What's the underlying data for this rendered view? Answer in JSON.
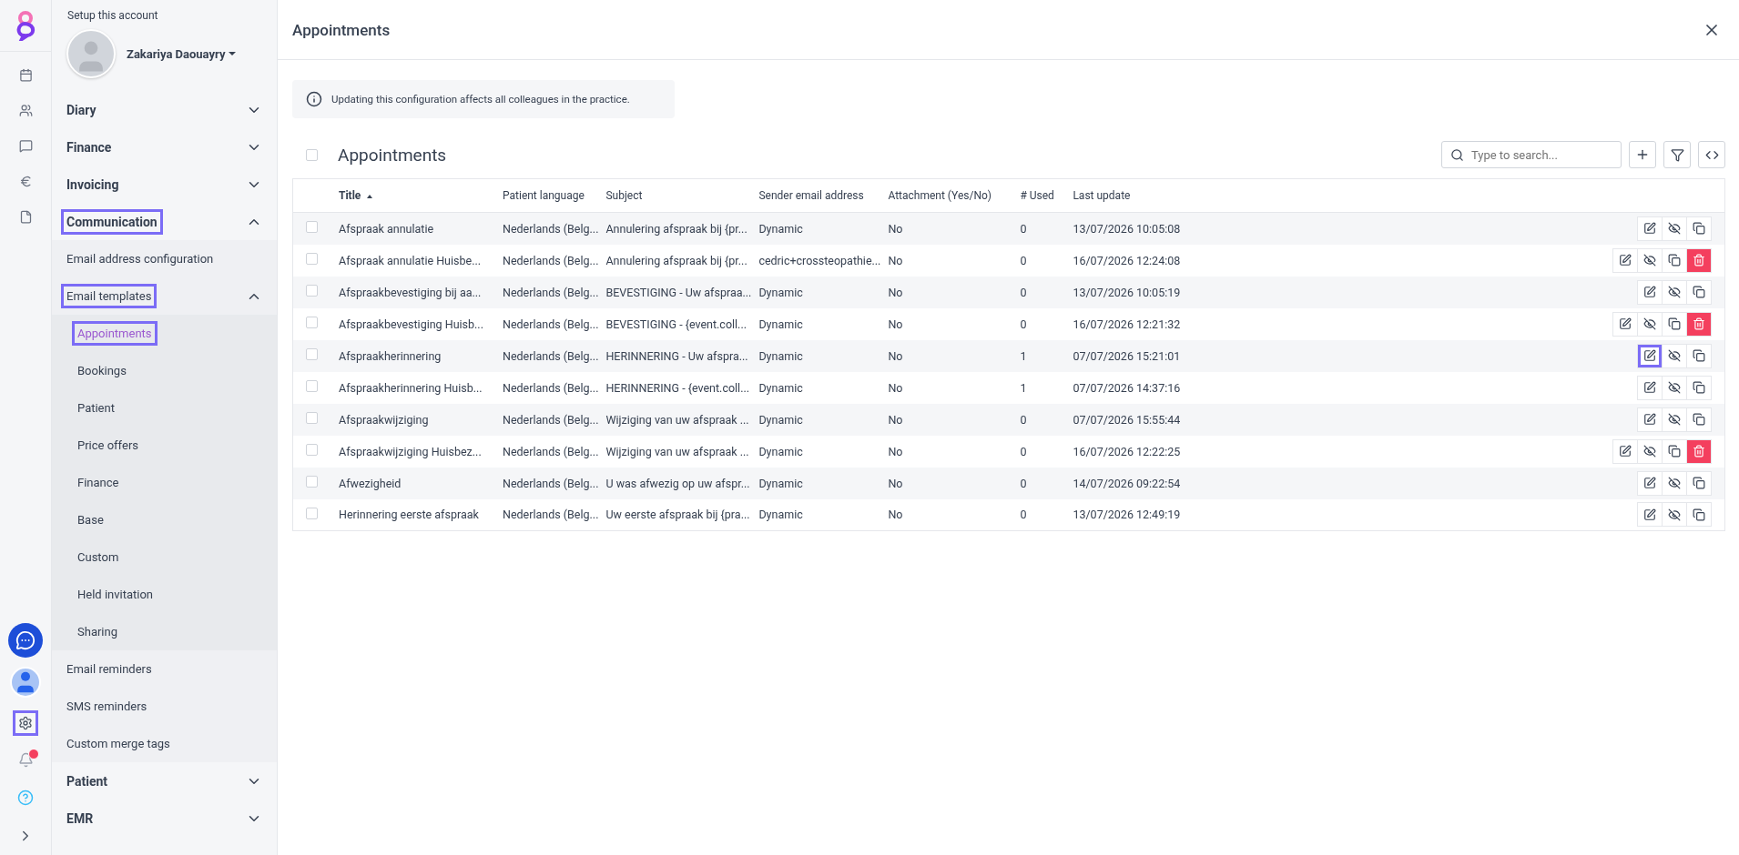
{
  "rail": {
    "top": [
      {
        "kind": "calendar"
      },
      {
        "kind": "users"
      },
      {
        "kind": "message"
      },
      {
        "kind": "euro"
      },
      {
        "kind": "file"
      }
    ],
    "bottom": [
      {
        "kind": "chat",
        "highlighted": false
      },
      {
        "kind": "avatar",
        "highlighted": false
      },
      {
        "kind": "settings",
        "highlighted": true
      },
      {
        "kind": "bell",
        "highlighted": false
      },
      {
        "kind": "help",
        "highlighted": false
      },
      {
        "kind": "expand",
        "highlighted": false
      }
    ]
  },
  "sidebar": {
    "caption": "Setup this account",
    "user": "Zakariya Daouayry",
    "sections": [
      {
        "label": "Diary",
        "expanded": false,
        "highlighted": false
      },
      {
        "label": "Finance",
        "expanded": false,
        "highlighted": false
      },
      {
        "label": "Invoicing",
        "expanded": false,
        "highlighted": false
      },
      {
        "label": "Communication",
        "expanded": true,
        "highlighted": true,
        "children": [
          {
            "label": "Email address configuration",
            "highlighted": false
          },
          {
            "label": "Email templates",
            "highlighted": true,
            "expanded": true,
            "children": [
              {
                "label": "Appointments",
                "selected": true,
                "highlighted": true
              },
              {
                "label": "Bookings",
                "selected": false,
                "highlighted": false
              },
              {
                "label": "Patient",
                "selected": false,
                "highlighted": false
              },
              {
                "label": "Price offers",
                "selected": false,
                "highlighted": false
              },
              {
                "label": "Finance",
                "selected": false,
                "highlighted": false
              },
              {
                "label": "Base",
                "selected": false,
                "highlighted": false
              },
              {
                "label": "Custom",
                "selected": false,
                "highlighted": false
              },
              {
                "label": "Held invitation",
                "selected": false,
                "highlighted": false
              },
              {
                "label": "Sharing",
                "selected": false,
                "highlighted": false
              }
            ]
          },
          {
            "label": "Email reminders",
            "highlighted": false
          },
          {
            "label": "SMS reminders",
            "highlighted": false
          },
          {
            "label": "Custom merge tags",
            "highlighted": false
          }
        ]
      },
      {
        "label": "Patient",
        "expanded": false,
        "highlighted": false
      },
      {
        "label": "EMR",
        "expanded": false,
        "highlighted": false
      }
    ]
  },
  "header": {
    "title": "Appointments"
  },
  "notice": "Updating this configuration affects all colleagues in the practice.",
  "table": {
    "title": "Appointments",
    "select_all_checked": false,
    "search": {
      "placeholder": "Type to search..."
    },
    "columns": [
      {
        "label": "Title",
        "sorted": true
      },
      {
        "label": "Patient language",
        "sorted": false
      },
      {
        "label": "Subject",
        "sorted": false
      },
      {
        "label": "Sender email address",
        "sorted": false
      },
      {
        "label": "Attachment (Yes/No)",
        "sorted": false
      },
      {
        "label": "# Used",
        "sorted": false
      },
      {
        "label": "Last update",
        "sorted": false
      }
    ],
    "rows": [
      {
        "checked": false,
        "cells": [
          "Afspraak annulatie",
          "Nederlands (Belg...",
          "Annulering afspraak bij {pr...",
          "Dynamic",
          "No",
          "0",
          "13/07/2026 10:05:08"
        ],
        "deletable": false,
        "edit_highlighted": false
      },
      {
        "checked": false,
        "cells": [
          "Afspraak annulatie Huisbe...",
          "Nederlands (Belg...",
          "Annulering afspraak bij {pr...",
          "cedric+crossteopathie...",
          "No",
          "0",
          "16/07/2026 12:24:08"
        ],
        "deletable": true,
        "edit_highlighted": false
      },
      {
        "checked": false,
        "cells": [
          "Afspraakbevestiging bij aa...",
          "Nederlands (Belg...",
          "BEVESTIGING - Uw afspraa...",
          "Dynamic",
          "No",
          "0",
          "13/07/2026 10:05:19"
        ],
        "deletable": false,
        "edit_highlighted": false
      },
      {
        "checked": false,
        "cells": [
          "Afspraakbevestiging Huisb...",
          "Nederlands (Belg...",
          "BEVESTIGING - {event.coll...",
          "Dynamic",
          "No",
          "0",
          "16/07/2026 12:21:32"
        ],
        "deletable": true,
        "edit_highlighted": false
      },
      {
        "checked": false,
        "cells": [
          "Afspraakherinnering",
          "Nederlands (Belg...",
          "HERINNERING - Uw afspra...",
          "Dynamic",
          "No",
          "1",
          "07/07/2026 15:21:01"
        ],
        "deletable": false,
        "edit_highlighted": true
      },
      {
        "checked": false,
        "cells": [
          "Afspraakherinnering Huisb...",
          "Nederlands (Belg...",
          "HERINNERING - {event.coll...",
          "Dynamic",
          "No",
          "1",
          "07/07/2026 14:37:16"
        ],
        "deletable": false,
        "edit_highlighted": false
      },
      {
        "checked": false,
        "cells": [
          "Afspraakwijziging",
          "Nederlands (Belg...",
          "Wijziging van uw afspraak ...",
          "Dynamic",
          "No",
          "0",
          "07/07/2026 15:55:44"
        ],
        "deletable": false,
        "edit_highlighted": false
      },
      {
        "checked": false,
        "cells": [
          "Afspraakwijziging Huisbez...",
          "Nederlands (Belg...",
          "Wijziging van uw afspraak ...",
          "Dynamic",
          "No",
          "0",
          "16/07/2026 12:22:25"
        ],
        "deletable": true,
        "edit_highlighted": false
      },
      {
        "checked": false,
        "cells": [
          "Afwezigheid",
          "Nederlands (Belg...",
          "U was afwezig op uw afspr...",
          "Dynamic",
          "No",
          "0",
          "14/07/2026 09:22:54"
        ],
        "deletable": false,
        "edit_highlighted": false
      },
      {
        "checked": false,
        "cells": [
          "Herinnering eerste afspraak",
          "Nederlands (Belg...",
          "Uw eerste afspraak bij {pra...",
          "Dynamic",
          "No",
          "0",
          "13/07/2026 12:49:19"
        ],
        "deletable": false,
        "edit_highlighted": false
      }
    ]
  }
}
